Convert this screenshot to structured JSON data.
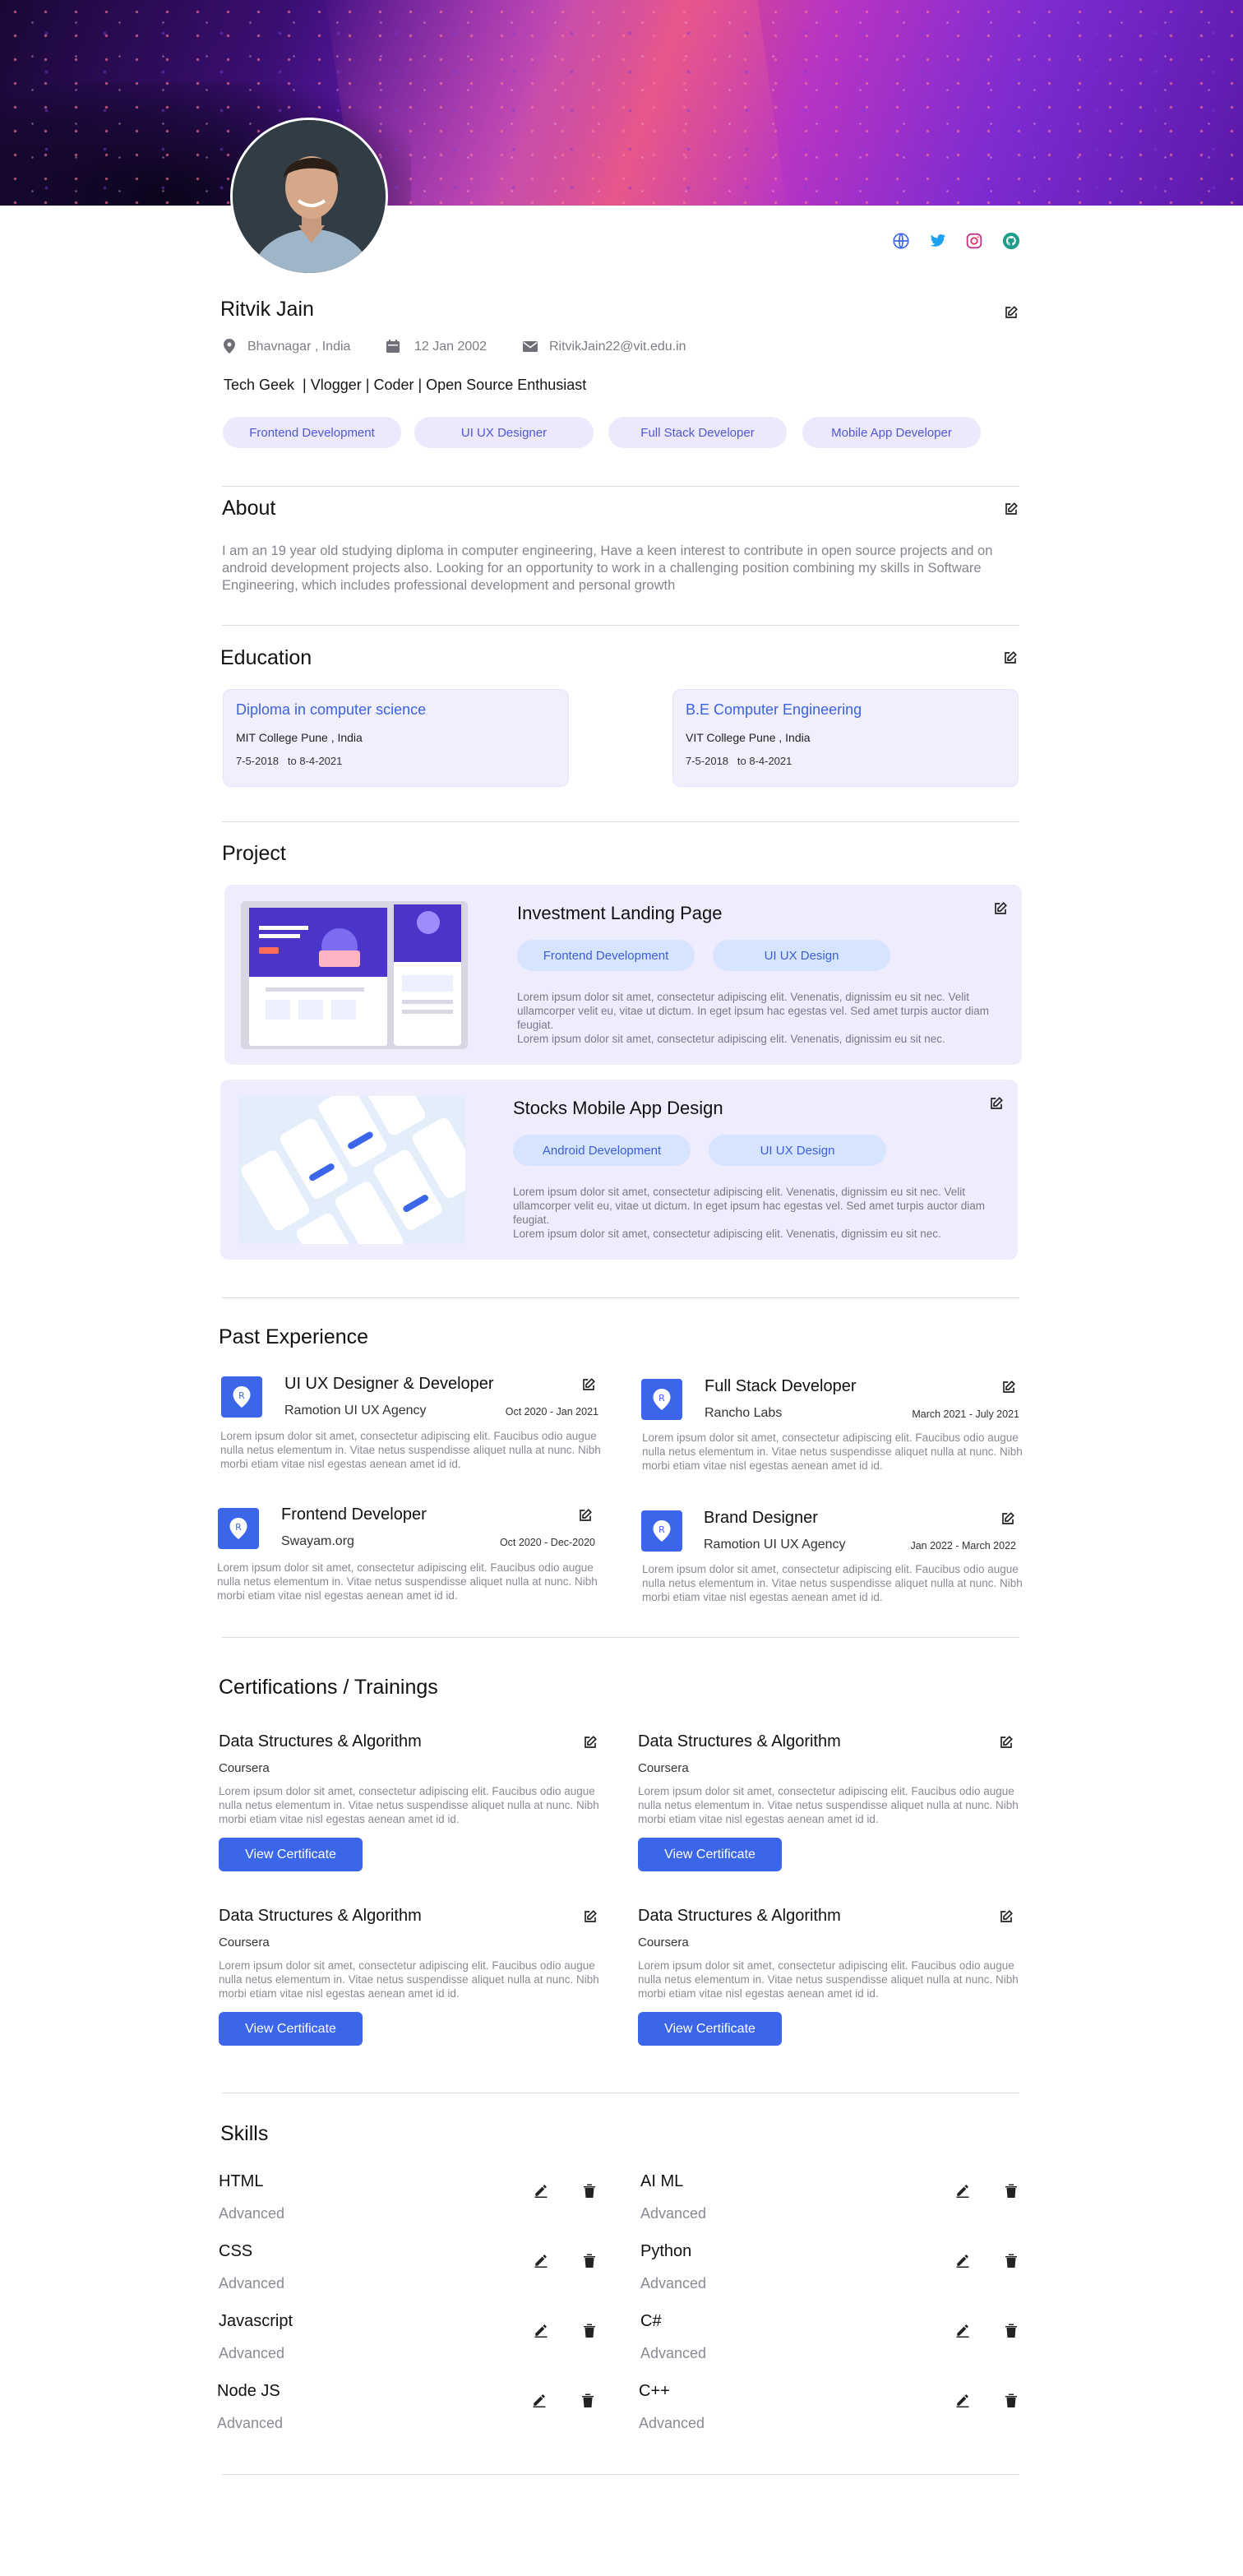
{
  "profile": {
    "name": "Ritvik Jain",
    "location": "Bhavnagar , India",
    "dob": "12 Jan 2002",
    "email": "RitvikJain22@vit.edu.in",
    "tagline": "Tech Geek  | Vlogger | Coder | Open Source Enthusiast",
    "tags": [
      "Frontend Development",
      "UI UX Designer",
      "Full Stack Developer",
      "Mobile App Developer"
    ]
  },
  "social": [
    "globe-icon",
    "twitter-icon",
    "instagram-icon",
    "github-icon"
  ],
  "about": {
    "title": "About",
    "text": "I am an 19 year old studying diploma in computer engineering, Have a keen interest to contribute in open source projects and on android development projects also. Looking for an opportunity to work in a challenging position combining my skills in Software Engineering, which includes professional development and personal growth"
  },
  "education": {
    "title": "Education",
    "items": [
      {
        "degree": "Diploma in computer science",
        "school": "MIT College Pune , India",
        "dates": "7-5-2018   to 8-4-2021"
      },
      {
        "degree": "B.E Computer Engineering",
        "school": "VIT College Pune , India",
        "dates": "7-5-2018   to 8-4-2021"
      }
    ]
  },
  "projects": {
    "title": "Project",
    "items": [
      {
        "name": "Investment Landing Page",
        "tags": [
          "Frontend Development",
          "UI UX Design"
        ],
        "desc": "Lorem ipsum dolor sit amet, consectetur adipiscing elit. Venenatis, dignissim eu sit nec. Velit ullamcorper velit eu, vitae ut dictum. In eget ipsum hac egestas vel. Sed amet turpis auctor diam feugiat.\nLorem ipsum dolor sit amet, consectetur adipiscing elit. Venenatis, dignissim eu sit nec."
      },
      {
        "name": "Stocks Mobile App Design",
        "tags": [
          "Android Development",
          "UI UX Design"
        ],
        "desc": "Lorem ipsum dolor sit amet, consectetur adipiscing elit. Venenatis, dignissim eu sit nec. Velit ullamcorper velit eu, vitae ut dictum. In eget ipsum hac egestas vel. Sed amet turpis auctor diam feugiat.\nLorem ipsum dolor sit amet, consectetur adipiscing elit. Venenatis, dignissim eu sit nec."
      }
    ]
  },
  "experience": {
    "title": "Past Experience",
    "items": [
      {
        "role": "UI UX Designer & Developer",
        "company": "Ramotion UI UX Agency",
        "dates": "Oct 2020 - Jan 2021",
        "desc": "Lorem ipsum dolor sit amet, consectetur adipiscing elit. Faucibus odio augue nulla netus elementum in. Vitae netus suspendisse aliquet nulla at nunc. Nibh morbi etiam vitae nisl egestas aenean amet id id."
      },
      {
        "role": "Full Stack Developer",
        "company": "Rancho Labs",
        "dates": "March 2021 - July 2021",
        "desc": "Lorem ipsum dolor sit amet, consectetur adipiscing elit. Faucibus odio augue nulla netus elementum in. Vitae netus suspendisse aliquet nulla at nunc. Nibh morbi etiam vitae nisl egestas aenean amet id id."
      },
      {
        "role": "Frontend Developer",
        "company": "Swayam.org",
        "dates": "Oct 2020 - Dec-2020",
        "desc": "Lorem ipsum dolor sit amet, consectetur adipiscing elit. Faucibus odio augue nulla netus elementum in. Vitae netus suspendisse aliquet nulla at nunc. Nibh morbi etiam vitae nisl egestas aenean amet id id."
      },
      {
        "role": "Brand Designer",
        "company": "Ramotion UI UX Agency",
        "dates": "Jan 2022 - March 2022",
        "desc": "Lorem ipsum dolor sit amet, consectetur adipiscing elit. Faucibus odio augue nulla netus elementum in. Vitae netus suspendisse aliquet nulla at nunc. Nibh morbi etiam vitae nisl egestas aenean amet id id."
      }
    ]
  },
  "certifications": {
    "title": "Certifications / Trainings",
    "button_label": "View Certificate",
    "items": [
      {
        "name": "Data Structures & Algorithm",
        "provider": "Coursera",
        "desc": "Lorem ipsum dolor sit amet, consectetur adipiscing elit. Faucibus odio augue nulla netus elementum in. Vitae netus suspendisse aliquet nulla at nunc. Nibh morbi etiam vitae nisl egestas aenean amet id id."
      },
      {
        "name": "Data Structures & Algorithm",
        "provider": "Coursera",
        "desc": "Lorem ipsum dolor sit amet, consectetur adipiscing elit. Faucibus odio augue nulla netus elementum in. Vitae netus suspendisse aliquet nulla at nunc. Nibh morbi etiam vitae nisl egestas aenean amet id id."
      },
      {
        "name": "Data Structures & Algorithm",
        "provider": "Coursera",
        "desc": "Lorem ipsum dolor sit amet, consectetur adipiscing elit. Faucibus odio augue nulla netus elementum in. Vitae netus suspendisse aliquet nulla at nunc. Nibh morbi etiam vitae nisl egestas aenean amet id id."
      },
      {
        "name": "Data Structures & Algorithm",
        "provider": "Coursera",
        "desc": "Lorem ipsum dolor sit amet, consectetur adipiscing elit. Faucibus odio augue nulla netus elementum in. Vitae netus suspendisse aliquet nulla at nunc. Nibh morbi etiam vitae nisl egestas aenean amet id id."
      }
    ]
  },
  "skills": {
    "title": "Skills",
    "items": [
      {
        "name": "HTML",
        "level": "Advanced"
      },
      {
        "name": "AI ML",
        "level": "Advanced"
      },
      {
        "name": "CSS",
        "level": "Advanced"
      },
      {
        "name": "Python",
        "level": "Advanced"
      },
      {
        "name": "Javascript",
        "level": "Advanced"
      },
      {
        "name": "C#",
        "level": "Advanced"
      },
      {
        "name": "Node JS",
        "level": "Advanced"
      },
      {
        "name": "C++",
        "level": "Advanced"
      }
    ]
  },
  "colors": {
    "accent": "#3b66ea",
    "chip_bg": "#ece9fc",
    "card_bg": "#efecfd"
  }
}
